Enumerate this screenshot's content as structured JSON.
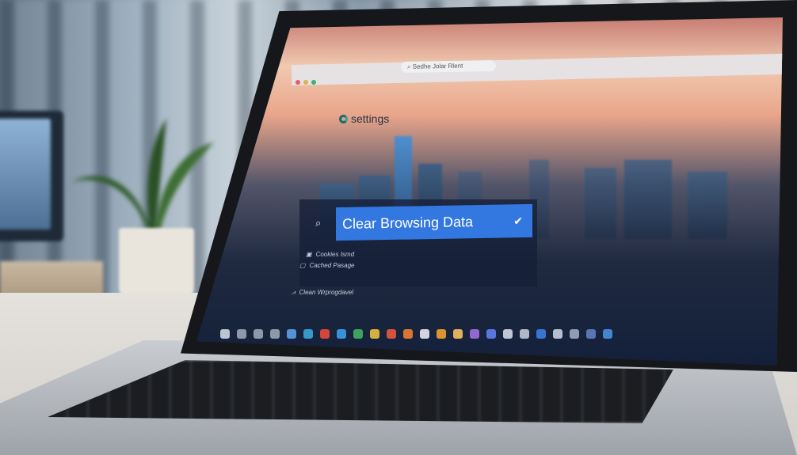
{
  "browser": {
    "address_bar": "Sedhe Jolar Rlent",
    "window_dots": [
      "#e0606a",
      "#e0b050",
      "#40b070"
    ]
  },
  "settings": {
    "title": "settings"
  },
  "clear_browsing": {
    "search_icon": "search-icon",
    "label": "Clear Browsing Data",
    "check_icon": "checkmark-icon"
  },
  "options": [
    {
      "icon": "cookie-icon",
      "label": "Cookies Ismd"
    },
    {
      "icon": "cache-icon",
      "label": "Cached Pasage"
    },
    {
      "icon": "broom-icon",
      "label": "Clean Wrprogdavel"
    }
  ],
  "taskbar": {
    "icons": [
      "#cfd6e2",
      "#9aa6b6",
      "#9aa6b6",
      "#9aa6b6",
      "#5aa0e8",
      "#3aa6d8",
      "#e84a3a",
      "#3aa0e8",
      "#40b060",
      "#e8c040",
      "#e85a3a",
      "#f08030",
      "#e8e8f0",
      "#f0a030",
      "#f8c060",
      "#a070e0",
      "#6080f0",
      "#d0d8e8",
      "#c0c8d8",
      "#3a80e0",
      "#c8d0e0",
      "#a0a8c0",
      "#6080c0",
      "#4a90e0"
    ]
  }
}
